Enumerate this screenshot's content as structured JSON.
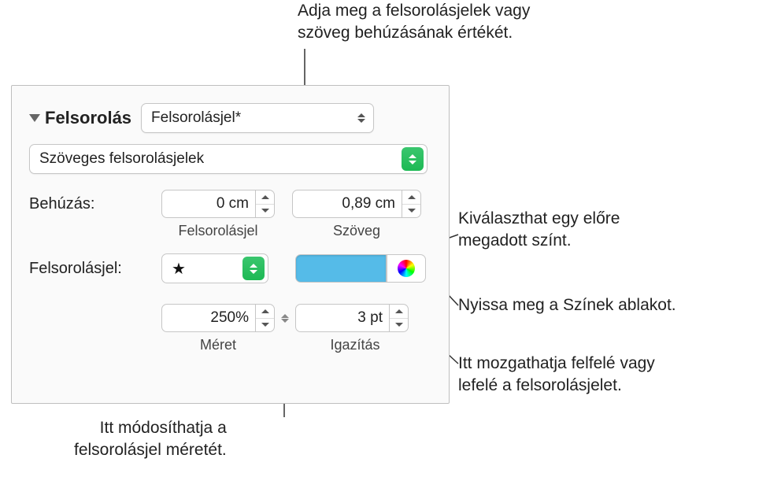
{
  "callouts": {
    "top": "Adja meg a felsorolásjelek vagy\nszöveg behúzásának értékét.",
    "r1": "Kiválaszthat egy előre\nmegadott színt.",
    "r2": "Nyissa meg a Színek ablakot.",
    "r3": "Itt mozgathatja felfelé vagy\nlefelé a felsorolásjelet.",
    "bottom": "Itt módosíthatja a\nfelsorolásjel méretét."
  },
  "panel": {
    "section_title": "Felsorolás",
    "style_selected": "Felsorolásjel*",
    "subtype_selected": "Szöveges felsorolásjelek",
    "indent_label": "Behúzás:",
    "indent_bullet_value": "0 cm",
    "indent_text_value": "0,89 cm",
    "indent_bullet_sub": "Felsorolásjel",
    "indent_text_sub": "Szöveg",
    "bullet_label": "Felsorolásjel:",
    "bullet_glyph": "★",
    "size_value": "250%",
    "size_label": "Méret",
    "align_value": "3 pt",
    "align_label": "Igazítás"
  },
  "colors": {
    "swatch": "#55bbe8",
    "green_accent": "#1db954"
  }
}
